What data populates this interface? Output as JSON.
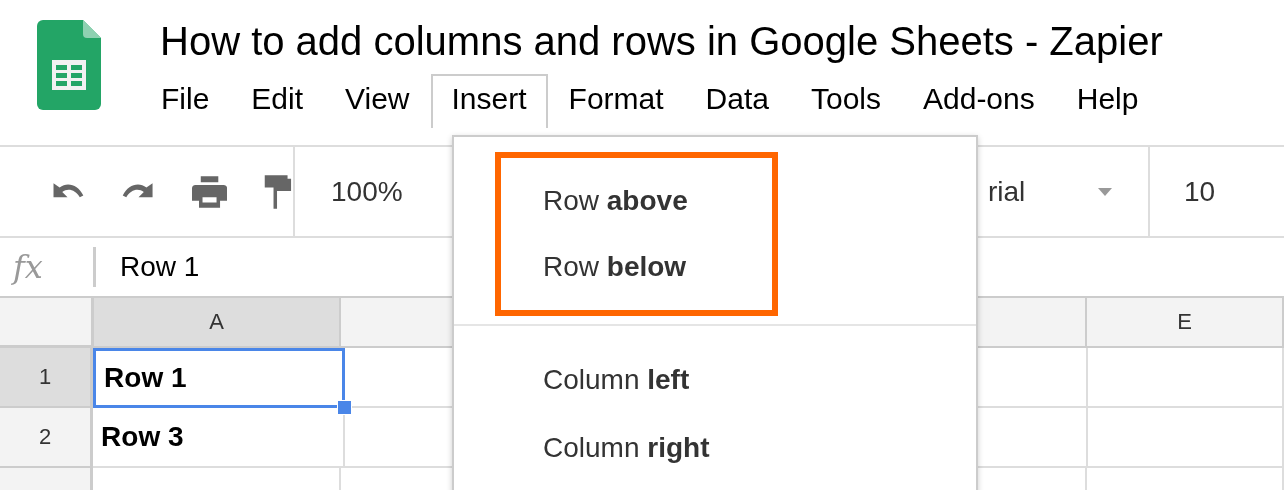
{
  "document": {
    "title": "How to add columns and rows in Google Sheets - Zapier"
  },
  "menu_bar": [
    {
      "label": "File",
      "selected": false
    },
    {
      "label": "Edit",
      "selected": false
    },
    {
      "label": "View",
      "selected": false
    },
    {
      "label": "Insert",
      "selected": true
    },
    {
      "label": "Format",
      "selected": false
    },
    {
      "label": "Data",
      "selected": false
    },
    {
      "label": "Tools",
      "selected": false
    },
    {
      "label": "Add-ons",
      "selected": false
    },
    {
      "label": "Help",
      "selected": false
    }
  ],
  "toolbar": {
    "zoom": "100%",
    "font": "rial",
    "font_size": "10"
  },
  "formula_bar": {
    "label": "fx",
    "value": "Row 1"
  },
  "columns": [
    {
      "label": "A",
      "selected": true
    },
    {
      "label": "E",
      "selected": false
    }
  ],
  "rows": [
    {
      "number": "1",
      "selected": true,
      "cells": [
        {
          "text": "Row 1",
          "selected": true
        }
      ]
    },
    {
      "number": "2",
      "selected": false,
      "cells": [
        {
          "text": "Row 3",
          "selected": false
        }
      ]
    }
  ],
  "insert_menu": {
    "groups": [
      {
        "highlighted": true,
        "items": [
          "Row **above**",
          "Row **below**"
        ]
      },
      {
        "highlighted": false,
        "items": [
          "Column **left**",
          "Column **right**"
        ]
      }
    ]
  }
}
